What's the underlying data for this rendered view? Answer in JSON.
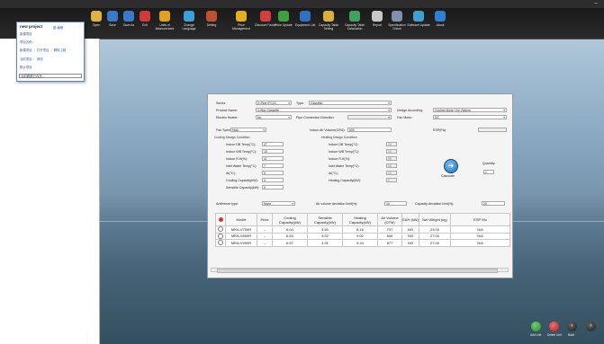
{
  "window": {
    "minimize_glyph": "–"
  },
  "toolbar": {
    "items": [
      {
        "label": "Open",
        "icon": "folder-open-icon",
        "color": "#e0b040"
      },
      {
        "label": "Save",
        "icon": "save-icon",
        "color": "#3a78c8"
      },
      {
        "label": "Save As",
        "icon": "save-as-icon",
        "color": "#3a78c8"
      },
      {
        "label": "Exit",
        "icon": "exit-icon",
        "color": "#d03a3a"
      },
      {
        "label": "Units of Measurement",
        "icon": "ruler-icon",
        "color": "#e0a020"
      },
      {
        "label": "Change Language",
        "icon": "globe-icon",
        "color": "#3aa0d8"
      },
      {
        "label": "Setting",
        "icon": "wrench-icon",
        "color": "#c05030"
      },
      {
        "label": "Price Management",
        "icon": "coin-icon",
        "color": "#e0b020"
      },
      {
        "label": "Discount Factor",
        "icon": "pie-chart-icon",
        "color": "#d04040"
      },
      {
        "label": "Price Update",
        "icon": "refresh-icon",
        "color": "#40a040"
      },
      {
        "label": "Equipment List",
        "icon": "list-icon",
        "color": "#3070c0"
      },
      {
        "label": "Capacity Table Setting",
        "icon": "gear-icon",
        "color": "#d8b040"
      },
      {
        "label": "Capacity Table Calculation",
        "icon": "calculator-icon",
        "color": "#40a060"
      },
      {
        "label": "Report",
        "icon": "printer-icon",
        "color": "#c8c8c8"
      },
      {
        "label": "Specification Check",
        "icon": "magnifier-icon",
        "color": "#8090b0"
      },
      {
        "label": "Software Update",
        "icon": "software-update-icon",
        "color": "#40a0d0"
      },
      {
        "label": "About",
        "icon": "about-icon",
        "color": "#3080d0"
      }
    ]
  },
  "project_popup": {
    "title": "new project",
    "title_extra": "图 编辑",
    "lines": [
      "新建项目",
      "项目名称：",
      "新建项目 ｜ 打开项目 ｜ 删除工程",
      "当前项目：",
      "修改",
      "默认项目"
    ],
    "select_value": "当前数据已存在..."
  },
  "form": {
    "series_label": "Series:",
    "series_value": "D-Pipe (FCU)",
    "type_label": "Type:",
    "type_value": "Cassette",
    "product_name_label": "Product Name:",
    "product_name_value": "4-Way Cassette",
    "design_according_label": "Design According:",
    "design_according_value": "Cooling Mode / Air Volume",
    "electric_heater_label": "Electric Heater:",
    "electric_heater_value": "No",
    "pipe_conn_label": "Pipe Connection Direction:",
    "pipe_conn_value": "",
    "fan_motor_label": "Fan Motor:",
    "fan_motor_value": "DC",
    "fan_speed_label": "Fan Speed:",
    "fan_speed_value": "High",
    "indoor_air_volume_label": "Indoor Air Volume(CFM):",
    "indoor_air_volume_value": "600",
    "esp_label": "ESP(Pa):",
    "esp_value": "",
    "cooling_group": "Cooling Design Condition",
    "heating_group": "Heating Design Condition",
    "cooling_fields": [
      {
        "label": "Indoor DB Temp(°C):",
        "value": "27"
      },
      {
        "label": "Indoor WB Temp(°C):",
        "value": "19"
      },
      {
        "label": "Indoor R.H(%):",
        "value": "47"
      },
      {
        "label": "Inlet Water Temp(°C):",
        "value": "7"
      },
      {
        "label": "Δt(°C):",
        "value": "5"
      },
      {
        "label": "Cooling Capacity(kW):",
        "value": "0"
      },
      {
        "label": "Sensible Capacity(kW):",
        "value": "0"
      }
    ],
    "heating_fields": [
      {
        "label": "Indoor DB Temp(°C):",
        "value": "20"
      },
      {
        "label": "Indoor WB Temp(°C):",
        "value": "15"
      },
      {
        "label": "Indoor R.H(%):",
        "value": "59"
      },
      {
        "label": "Inlet Water Temp(°C):",
        "value": "50"
      },
      {
        "label": "Δt(°C):",
        "value": "10"
      },
      {
        "label": "Heating Capacity(kW):",
        "value": "0"
      }
    ],
    "calculate_label": "Calculate",
    "quantity_label": "Quantity:",
    "quantity_value": "1",
    "antifreeze_label": "Antifreeze type:",
    "antifreeze_value": "None",
    "air_dev_label": "Air volume deviation limit(%):",
    "air_dev_value": "10",
    "cap_dev_label": "Capacity deviation limit(%):",
    "cap_dev_value": "20"
  },
  "results": {
    "columns": [
      "",
      "Model",
      "Price",
      "Cooling Capacity(kW)",
      "Sensible Capacity(kW)",
      "Heating Capacity(kW)",
      "Air Volume (CFM)",
      "EAH (kW)",
      "Net Weight (kg)",
      "ESP Mu"
    ],
    "rows": [
      [
        "MKA-V750R",
        "--",
        "6.04",
        "4.50",
        "8.16",
        "737",
        "NO",
        "23.00",
        "N/A"
      ],
      [
        "MKA-V850R",
        "--",
        "6.53",
        "4.92",
        "9.02",
        "846",
        "NO",
        "27.00",
        "N/A"
      ],
      [
        "MKA-V950R",
        "--",
        "6.57",
        "4.91",
        "9.34",
        "877",
        "NO",
        "27.00",
        "N/A"
      ]
    ]
  },
  "bottom_buttons": [
    {
      "label": "Add Unit",
      "icon": "add-icon",
      "color": "#3aa040"
    },
    {
      "label": "Delete Unit",
      "icon": "delete-icon",
      "color": "#d03a3a"
    },
    {
      "label": "Back",
      "icon": "back-icon",
      "color": "#333333"
    },
    {
      "label": "",
      "icon": "forward-icon",
      "color": "#333333"
    }
  ]
}
